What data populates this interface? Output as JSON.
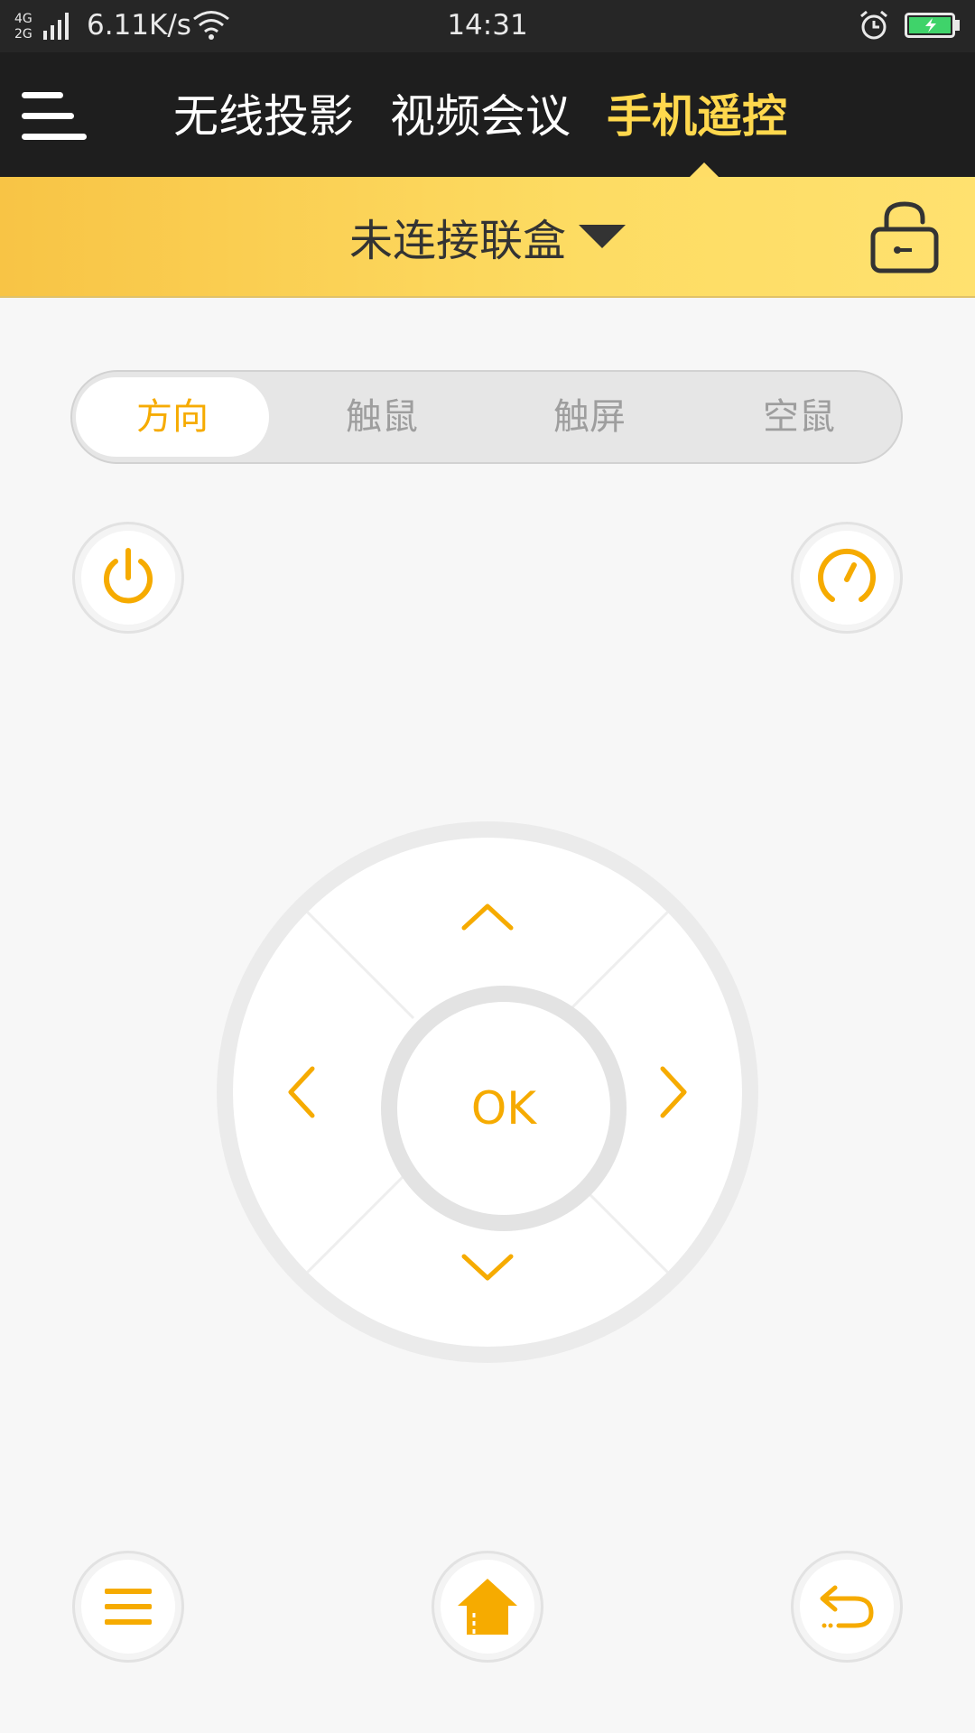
{
  "status_bar": {
    "network": "4G 2G",
    "speed": "6.11K/s",
    "time": "14:31",
    "icons": [
      "signal-icon",
      "wifi-icon",
      "alarm-icon",
      "battery-charging-icon"
    ]
  },
  "header": {
    "menu_icon": "hamburger-menu-icon",
    "tabs": [
      {
        "label": "无线投影",
        "active": false
      },
      {
        "label": "视频会议",
        "active": false
      },
      {
        "label": "手机遥控",
        "active": true
      }
    ]
  },
  "connection": {
    "label": "未连接联盒",
    "dropdown_icon": "triangle-down-icon",
    "lock_icon": "unlock-icon"
  },
  "modes": {
    "items": [
      {
        "label": "方向",
        "active": true
      },
      {
        "label": "触鼠",
        "active": false
      },
      {
        "label": "触屏",
        "active": false
      },
      {
        "label": "空鼠",
        "active": false
      }
    ]
  },
  "remote": {
    "power_icon": "power-icon",
    "speed_icon": "gauge-icon",
    "ok_label": "OK",
    "bottom_icons": [
      "menu-lines-icon",
      "home-icon",
      "return-icon"
    ]
  },
  "colors": {
    "accent": "#f6ab00",
    "header_bg": "#1e1e1e",
    "active_tab": "#ffd84d",
    "conn_bar": "#fddc63"
  }
}
